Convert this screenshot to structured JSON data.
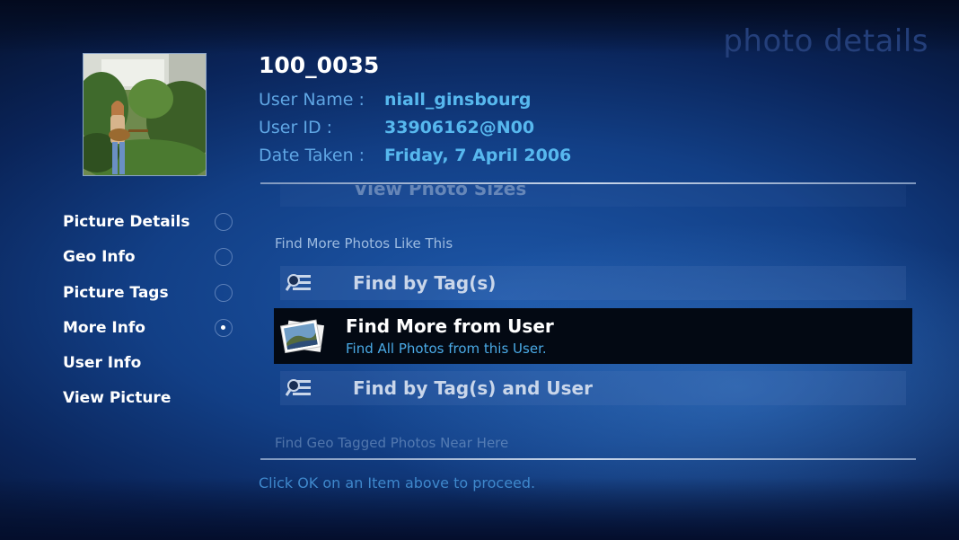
{
  "page": {
    "title": "photo details"
  },
  "photo": {
    "title": "100_0035",
    "thumbnail_alt": "Person with guitar in garden",
    "meta": [
      {
        "label": "User Name :",
        "value": "niall_ginsbourg"
      },
      {
        "label": "User ID :",
        "value": "33906162@N00"
      },
      {
        "label": "Date Taken :",
        "value": "Friday, 7 April 2006"
      }
    ]
  },
  "sidebar": {
    "items": [
      {
        "label": "Picture Details",
        "radio": "empty"
      },
      {
        "label": "Geo Info",
        "radio": "empty"
      },
      {
        "label": "Picture Tags",
        "radio": "empty"
      },
      {
        "label": "More Info",
        "radio": "selected"
      },
      {
        "label": "User Info",
        "radio": "none"
      },
      {
        "label": "View Picture",
        "radio": "none"
      }
    ]
  },
  "list": {
    "cut_top_label": "View Photo Sizes",
    "section_label": "Find More Photos Like This",
    "items": [
      {
        "label": "Find by Tag(s)",
        "icon": "tag-search-icon"
      },
      {
        "label": "Find More from User",
        "subtitle": "Find All Photos from this User.",
        "icon": "photo-stack-icon",
        "selected": true
      },
      {
        "label": "Find by Tag(s) and User",
        "icon": "tag-search-icon"
      }
    ],
    "cut_bottom_label": "Find Geo Tagged Photos Near Here"
  },
  "footer": {
    "hint": "Click OK on an Item above to proceed."
  },
  "colors": {
    "accent": "#57b8ee",
    "selection_bg": "#030913",
    "background": "#123f86"
  }
}
